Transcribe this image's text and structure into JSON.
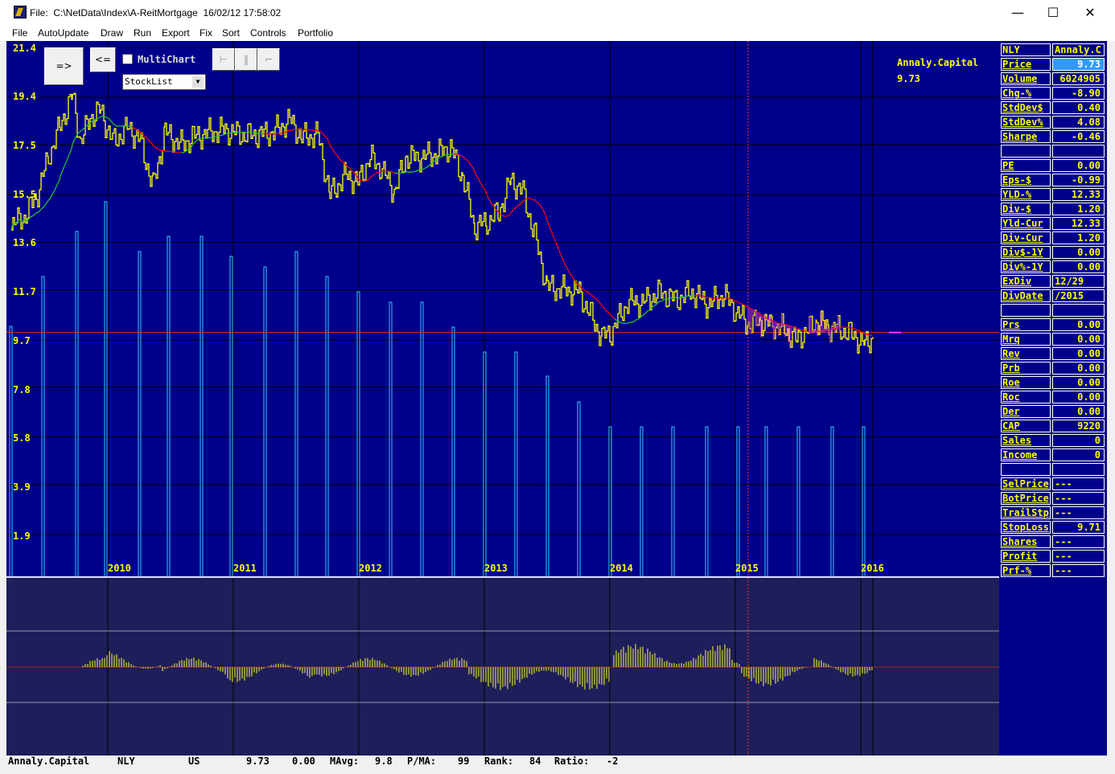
{
  "window": {
    "title_label": "File:",
    "title_path": "C:\\NetData\\Index\\A-ReitMortgage",
    "title_datetime": "16/02/12 17:58:02",
    "minimize": "—",
    "maximize": "☐",
    "close": "✕"
  },
  "menu": [
    "File",
    "AutoUpdate",
    "Draw",
    "Run",
    "Export",
    "Fix",
    "Sort",
    "Controls",
    "Portfolio"
  ],
  "controls": {
    "next_button": "=>",
    "prev_button": "<=",
    "multichart_label": "MultiChart",
    "multichart_checked": false,
    "stocklist_value": "StockList"
  },
  "chart": {
    "stock_name": "Annaly.Capital",
    "stock_price": "9.73",
    "y_ticks": [
      "21.4",
      "19.4",
      "17.5",
      "15.5",
      "13.6",
      "11.7",
      "9.7",
      "7.8",
      "5.8",
      "3.9",
      "1.9"
    ],
    "years": [
      "2010",
      "2011",
      "2012",
      "2013",
      "2014",
      "2015",
      "2016"
    ],
    "colors": {
      "background": "#00008b",
      "price": "#ffff00",
      "ma_red": "#ff0000",
      "ma_green": "#22cc22",
      "volume": "#33ccff",
      "divergence": "#cc33cc",
      "oscillator": "#ffff33"
    }
  },
  "chart_data": {
    "type": "line",
    "x": [
      "2010",
      "2011",
      "2012",
      "2013",
      "2014",
      "2015",
      "2016"
    ],
    "series": [
      {
        "values": [
          14.2,
          18.0,
          17.6,
          16.8,
          10.4,
          10.6,
          9.73
        ]
      }
    ],
    "ylim": [
      1.9,
      21.4
    ],
    "grid": true
  },
  "panel": [
    {
      "label": "NLY",
      "value": "Annaly.C",
      "label_plain": true,
      "value_left": true
    },
    {
      "label": "Price",
      "value": "9.73",
      "selected": true
    },
    {
      "label": "Volume",
      "value": "6024905"
    },
    {
      "label": "Chg-%",
      "value": "-8.90"
    },
    {
      "label": "StdDev$",
      "value": "0.40"
    },
    {
      "label": "StdDev%",
      "value": "4.08"
    },
    {
      "label": "Sharpe",
      "value": "-0.46"
    },
    {
      "label": "",
      "value": ""
    },
    {
      "label": "PE",
      "value": "0.00"
    },
    {
      "label": "Eps-$",
      "value": "-0.99"
    },
    {
      "label": "YLD-%",
      "value": "12.33"
    },
    {
      "label": "Div-$",
      "value": "1.20"
    },
    {
      "label": "Yld-Cur",
      "value": "12.33"
    },
    {
      "label": "Div-Cur",
      "value": "1.20"
    },
    {
      "label": "Div$-1Y",
      "value": "0.00"
    },
    {
      "label": "Div%-1Y",
      "value": "0.00"
    },
    {
      "label": "ExDiv",
      "value": "12/29",
      "value_left": true
    },
    {
      "label": "DivDate",
      "value": "/2015",
      "value_left": true
    },
    {
      "label": "",
      "value": ""
    },
    {
      "label": "Prs",
      "value": "0.00"
    },
    {
      "label": "Mrq",
      "value": "0.00"
    },
    {
      "label": "Rev",
      "value": "0.00"
    },
    {
      "label": "Prb",
      "value": "0.00"
    },
    {
      "label": "Roe",
      "value": "0.00"
    },
    {
      "label": "Roc",
      "value": "0.00"
    },
    {
      "label": "Der",
      "value": "0.00"
    },
    {
      "label": "CAP",
      "value": "9220"
    },
    {
      "label": "Sales",
      "value": "0"
    },
    {
      "label": "Income",
      "value": "0"
    },
    {
      "label": "",
      "value": ""
    },
    {
      "label": "SelPrice",
      "value": "---",
      "value_left": true
    },
    {
      "label": "BotPrice",
      "value": "---",
      "value_left": true
    },
    {
      "label": "TrailStp",
      "value": "---",
      "value_left": true
    },
    {
      "label": "StopLoss",
      "value": "9.71"
    },
    {
      "label": "Shares",
      "value": "---",
      "value_left": true
    },
    {
      "label": "Profit",
      "value": "---",
      "value_left": true
    },
    {
      "label": "Prf-%",
      "value": "---",
      "value_left": true
    }
  ],
  "status": {
    "name": "Annaly.Capital",
    "symbol": "NLY",
    "country": "US",
    "price": "9.73",
    "change": "0.00",
    "mavg_label": "MAvg:",
    "mavg_value": "9.8",
    "pma_label": "P/MA:",
    "pma_value": "99",
    "rank_label": "Rank:",
    "rank_value": "84",
    "ratio_label": "Ratio:",
    "ratio_value": "-2"
  }
}
